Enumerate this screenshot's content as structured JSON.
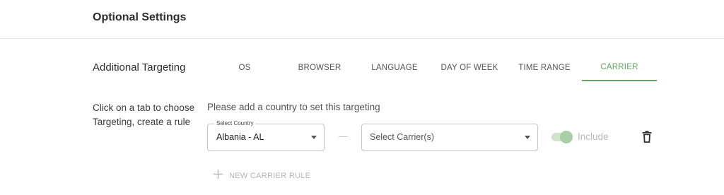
{
  "header": {
    "title": "Optional Settings"
  },
  "section": {
    "title": "Additional Targeting"
  },
  "tabs": [
    {
      "label": "OS",
      "active": false
    },
    {
      "label": "BROWSER",
      "active": false
    },
    {
      "label": "LANGUAGE",
      "active": false
    },
    {
      "label": "DAY OF WEEK",
      "active": false
    },
    {
      "label": "TIME RANGE",
      "active": false
    },
    {
      "label": "CARRIER",
      "active": true
    }
  ],
  "helper_text": "Click on a tab to choose Targeting, create a rule",
  "hint_text": "Please add a country to set this targeting",
  "rule": {
    "country_label": "Select Country",
    "country_value": "Albania - AL",
    "carrier_placeholder": "Select Carrier(s)",
    "include_label": "Include",
    "include_enabled": true
  },
  "new_rule_label": "NEW CARRIER RULE",
  "colors": {
    "accent": "#63a361",
    "toggle_track": "#cfe3cd",
    "toggle_thumb": "#a8cfa6",
    "muted": "#b5b5b5"
  },
  "icons": {
    "dropdown": "chevron-down-icon",
    "delete": "trash-icon",
    "add": "plus-icon"
  }
}
